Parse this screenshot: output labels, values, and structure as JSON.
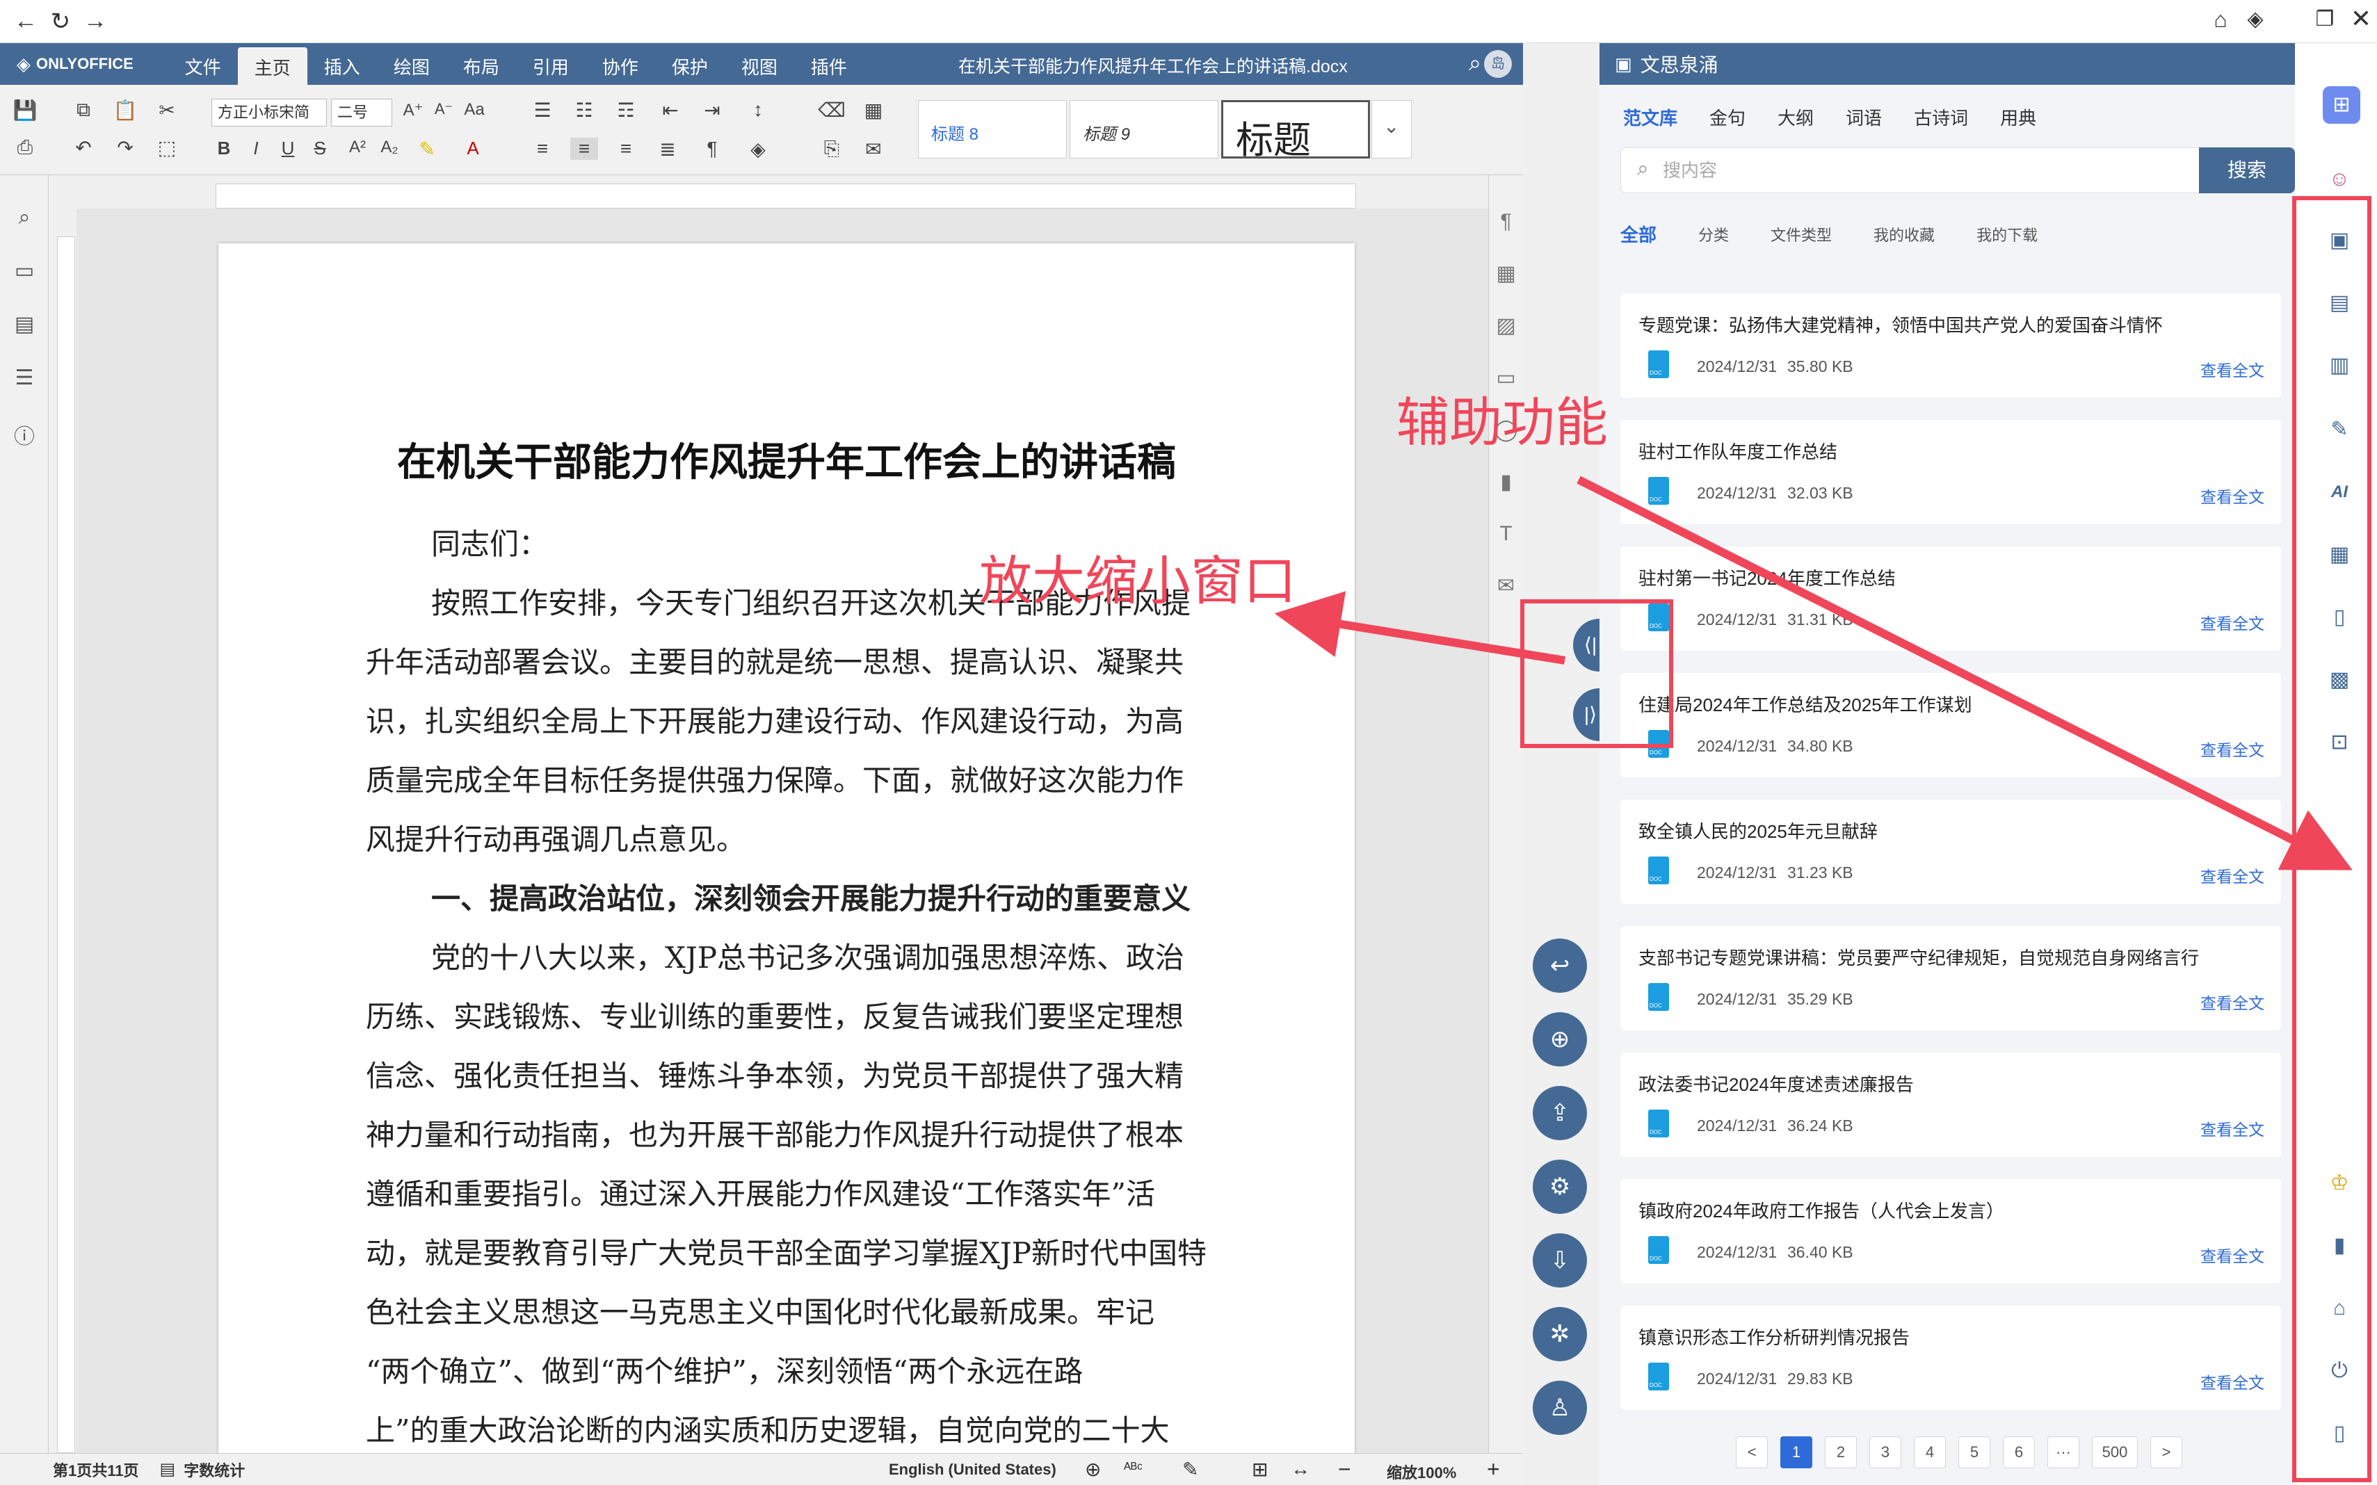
{
  "browser": {
    "back": "←",
    "reload": "↻",
    "forward": "→"
  },
  "titlebar": {
    "logo": "ONLYOFFICE",
    "menus": [
      "文件",
      "主页",
      "插入",
      "绘图",
      "布局",
      "引用",
      "协作",
      "保护",
      "视图",
      "插件"
    ],
    "active_menu": "主页",
    "doc_name": "在机关干部能力作风提升年工作会上的讲话稿.docx",
    "avatar": "岛"
  },
  "toolbar": {
    "font_name": "方正小标宋简",
    "font_size": "二号",
    "style_1": "标题 8",
    "style_2": "标题 9",
    "style_3": "标题"
  },
  "document": {
    "title": "在机关干部能力作风提升年工作会上的讲话稿",
    "paragraphs": [
      "同志们：",
      "按照工作安排，今天专门组织召开这次机关干部能力作风提",
      "升年活动部署会议。主要目的就是统一思想、提高认识、凝聚共",
      "识，扎实组织全局上下开展能力建设行动、作风建设行动，为高",
      "质量完成全年目标任务提供强力保障。下面，就做好这次能力作",
      "风提升行动再强调几点意见。",
      "一、提高政治站位，深刻领会开展能力提升行动的重要意义",
      "党的十八大以来，XJP总书记多次强调加强思想淬炼、政治",
      "历练、实践锻炼、专业训练的重要性，反复告诫我们要坚定理想",
      "信念、强化责任担当、锤炼斗争本领，为党员干部提供了强大精",
      "神力量和行动指南，也为开展干部能力作风提升行动提供了根本",
      "遵循和重要指引。通过深入开展能力作风建设“工作落实年”活",
      "动，就是要教育引导广大党员干部全面学习掌握XJP新时代中国特",
      "色社会主义思想这一马克思主义中国化时代化最新成果。牢记",
      "“两个确立”、做到“两个维护”，深刻领悟“两个永远在路",
      "上”的重大政治论断的内涵实质和历史逻辑，自觉向党的二十大"
    ]
  },
  "status": {
    "page_info": "第1页共11页",
    "word_count": "字数统计",
    "language": "English (United States)",
    "zoom": "缩放100%"
  },
  "panel": {
    "title": "文思泉涌",
    "tabs": [
      "范文库",
      "金句",
      "大纲",
      "词语",
      "古诗词",
      "用典"
    ],
    "search_placeholder": "搜内容",
    "search_button": "搜索",
    "filters": [
      "全部",
      "分类",
      "文件类型",
      "我的收藏",
      "我的下载"
    ],
    "results": [
      {
        "title": "专题党课：弘扬伟大建党精神，领悟中国共产党人的爱国奋斗情怀",
        "date": "2024/12/31",
        "size": "35.80 KB",
        "link": "查看全文"
      },
      {
        "title": "驻村工作队年度工作总结",
        "date": "2024/12/31",
        "size": "32.03 KB",
        "link": "查看全文"
      },
      {
        "title": "驻村第一书记2024年度工作总结",
        "date": "2024/12/31",
        "size": "31.31 KB",
        "link": "查看全文"
      },
      {
        "title": "住建局2024年工作总结及2025年工作谋划",
        "date": "2024/12/31",
        "size": "34.80 KB",
        "link": "查看全文"
      },
      {
        "title": "致全镇人民的2025年元旦献辞",
        "date": "2024/12/31",
        "size": "31.23 KB",
        "link": "查看全文"
      },
      {
        "title": "支部书记专题党课讲稿：党员要严守纪律规矩，自觉规范自身网络言行",
        "date": "2024/12/31",
        "size": "35.29 KB",
        "link": "查看全文"
      },
      {
        "title": "政法委书记2024年度述责述廉报告",
        "date": "2024/12/31",
        "size": "36.24 KB",
        "link": "查看全文"
      },
      {
        "title": "镇政府2024年政府工作报告（人代会上发言）",
        "date": "2024/12/31",
        "size": "36.40 KB",
        "link": "查看全文"
      },
      {
        "title": "镇意识形态工作分析研判情况报告",
        "date": "2024/12/31",
        "size": "29.83 KB",
        "link": "查看全文"
      }
    ],
    "pagination": [
      "<",
      "1",
      "2",
      "3",
      "4",
      "5",
      "6",
      "···",
      "500",
      ">"
    ],
    "active_page": "1"
  },
  "annotations": {
    "assist": "辅助功能",
    "resize": "放大缩小窗口"
  },
  "colors": {
    "brand": "#446995",
    "accent": "#2f6bd8",
    "annotation": "#f0465a"
  }
}
